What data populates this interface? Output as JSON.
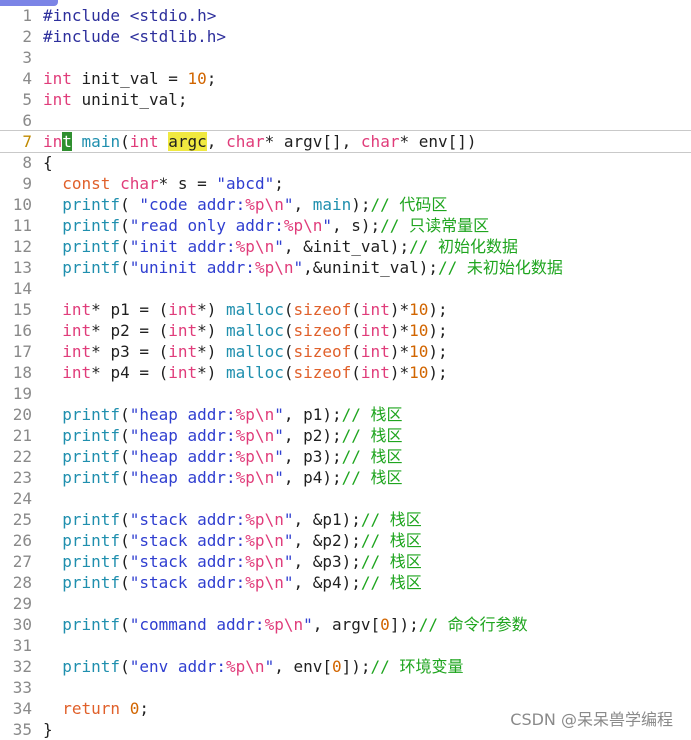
{
  "editor": {
    "current_line": 7,
    "lines": [
      {
        "n": "1",
        "t": [
          {
            "c": "tok-pp",
            "s": "#include <stdio.h>"
          }
        ]
      },
      {
        "n": "2",
        "t": [
          {
            "c": "tok-pp",
            "s": "#include <stdlib.h>"
          }
        ]
      },
      {
        "n": "3",
        "t": []
      },
      {
        "n": "4",
        "t": [
          {
            "c": "tok-type",
            "s": "int"
          },
          {
            "c": "tok-plain",
            "s": " init_val = "
          },
          {
            "c": "tok-num",
            "s": "10"
          },
          {
            "c": "tok-plain",
            "s": ";"
          }
        ]
      },
      {
        "n": "5",
        "t": [
          {
            "c": "tok-type",
            "s": "int"
          },
          {
            "c": "tok-plain",
            "s": " uninit_val;"
          }
        ]
      },
      {
        "n": "6",
        "t": []
      },
      {
        "n": "7",
        "t": [
          {
            "c": "tok-type",
            "s": "in"
          },
          {
            "c": "tok-cur",
            "s": "t"
          },
          {
            "c": "tok-plain",
            "s": " "
          },
          {
            "c": "tok-fn",
            "s": "main"
          },
          {
            "c": "tok-plain",
            "s": "("
          },
          {
            "c": "tok-type",
            "s": "int"
          },
          {
            "c": "tok-plain",
            "s": " "
          },
          {
            "c": "tok-hl tok-plain",
            "s": "argc"
          },
          {
            "c": "tok-plain",
            "s": ", "
          },
          {
            "c": "tok-type",
            "s": "char"
          },
          {
            "c": "tok-plain",
            "s": "* argv[], "
          },
          {
            "c": "tok-type",
            "s": "char"
          },
          {
            "c": "tok-plain",
            "s": "* env[])"
          }
        ]
      },
      {
        "n": "8",
        "t": [
          {
            "c": "tok-plain",
            "s": "{"
          }
        ]
      },
      {
        "n": "9",
        "t": [
          {
            "c": "tok-plain",
            "s": "  "
          },
          {
            "c": "tok-kw",
            "s": "const"
          },
          {
            "c": "tok-plain",
            "s": " "
          },
          {
            "c": "tok-type",
            "s": "char"
          },
          {
            "c": "tok-plain",
            "s": "* s = "
          },
          {
            "c": "tok-str",
            "s": "\"abcd\""
          },
          {
            "c": "tok-plain",
            "s": ";"
          }
        ]
      },
      {
        "n": "10",
        "t": [
          {
            "c": "tok-plain",
            "s": "  "
          },
          {
            "c": "tok-fn",
            "s": "printf"
          },
          {
            "c": "tok-plain",
            "s": "( "
          },
          {
            "c": "tok-str",
            "s": "\"code addr:"
          },
          {
            "c": "tok-fmt",
            "s": "%p\\n"
          },
          {
            "c": "tok-str",
            "s": "\""
          },
          {
            "c": "tok-plain",
            "s": ", "
          },
          {
            "c": "tok-fn",
            "s": "main"
          },
          {
            "c": "tok-plain",
            "s": ");"
          },
          {
            "c": "tok-cmt",
            "s": "// 代码区"
          }
        ]
      },
      {
        "n": "11",
        "t": [
          {
            "c": "tok-plain",
            "s": "  "
          },
          {
            "c": "tok-fn",
            "s": "printf"
          },
          {
            "c": "tok-plain",
            "s": "("
          },
          {
            "c": "tok-str",
            "s": "\"read only addr:"
          },
          {
            "c": "tok-fmt",
            "s": "%p\\n"
          },
          {
            "c": "tok-str",
            "s": "\""
          },
          {
            "c": "tok-plain",
            "s": ", s);"
          },
          {
            "c": "tok-cmt",
            "s": "// 只读常量区"
          }
        ]
      },
      {
        "n": "12",
        "t": [
          {
            "c": "tok-plain",
            "s": "  "
          },
          {
            "c": "tok-fn",
            "s": "printf"
          },
          {
            "c": "tok-plain",
            "s": "("
          },
          {
            "c": "tok-str",
            "s": "\"init addr:"
          },
          {
            "c": "tok-fmt",
            "s": "%p\\n"
          },
          {
            "c": "tok-str",
            "s": "\""
          },
          {
            "c": "tok-plain",
            "s": ", &init_val);"
          },
          {
            "c": "tok-cmt",
            "s": "// 初始化数据"
          }
        ]
      },
      {
        "n": "13",
        "t": [
          {
            "c": "tok-plain",
            "s": "  "
          },
          {
            "c": "tok-fn",
            "s": "printf"
          },
          {
            "c": "tok-plain",
            "s": "("
          },
          {
            "c": "tok-str",
            "s": "\"uninit addr:"
          },
          {
            "c": "tok-fmt",
            "s": "%p\\n"
          },
          {
            "c": "tok-str",
            "s": "\""
          },
          {
            "c": "tok-plain",
            "s": ",&uninit_val);"
          },
          {
            "c": "tok-cmt",
            "s": "// 未初始化数据"
          }
        ]
      },
      {
        "n": "14",
        "t": []
      },
      {
        "n": "15",
        "t": [
          {
            "c": "tok-plain",
            "s": "  "
          },
          {
            "c": "tok-type",
            "s": "int"
          },
          {
            "c": "tok-plain",
            "s": "* p1 = ("
          },
          {
            "c": "tok-type",
            "s": "int"
          },
          {
            "c": "tok-plain",
            "s": "*) "
          },
          {
            "c": "tok-fn",
            "s": "malloc"
          },
          {
            "c": "tok-plain",
            "s": "("
          },
          {
            "c": "tok-kw",
            "s": "sizeof"
          },
          {
            "c": "tok-plain",
            "s": "("
          },
          {
            "c": "tok-type",
            "s": "int"
          },
          {
            "c": "tok-plain",
            "s": ")*"
          },
          {
            "c": "tok-num",
            "s": "10"
          },
          {
            "c": "tok-plain",
            "s": ");"
          }
        ]
      },
      {
        "n": "16",
        "t": [
          {
            "c": "tok-plain",
            "s": "  "
          },
          {
            "c": "tok-type",
            "s": "int"
          },
          {
            "c": "tok-plain",
            "s": "* p2 = ("
          },
          {
            "c": "tok-type",
            "s": "int"
          },
          {
            "c": "tok-plain",
            "s": "*) "
          },
          {
            "c": "tok-fn",
            "s": "malloc"
          },
          {
            "c": "tok-plain",
            "s": "("
          },
          {
            "c": "tok-kw",
            "s": "sizeof"
          },
          {
            "c": "tok-plain",
            "s": "("
          },
          {
            "c": "tok-type",
            "s": "int"
          },
          {
            "c": "tok-plain",
            "s": ")*"
          },
          {
            "c": "tok-num",
            "s": "10"
          },
          {
            "c": "tok-plain",
            "s": ");"
          }
        ]
      },
      {
        "n": "17",
        "t": [
          {
            "c": "tok-plain",
            "s": "  "
          },
          {
            "c": "tok-type",
            "s": "int"
          },
          {
            "c": "tok-plain",
            "s": "* p3 = ("
          },
          {
            "c": "tok-type",
            "s": "int"
          },
          {
            "c": "tok-plain",
            "s": "*) "
          },
          {
            "c": "tok-fn",
            "s": "malloc"
          },
          {
            "c": "tok-plain",
            "s": "("
          },
          {
            "c": "tok-kw",
            "s": "sizeof"
          },
          {
            "c": "tok-plain",
            "s": "("
          },
          {
            "c": "tok-type",
            "s": "int"
          },
          {
            "c": "tok-plain",
            "s": ")*"
          },
          {
            "c": "tok-num",
            "s": "10"
          },
          {
            "c": "tok-plain",
            "s": ");"
          }
        ]
      },
      {
        "n": "18",
        "t": [
          {
            "c": "tok-plain",
            "s": "  "
          },
          {
            "c": "tok-type",
            "s": "int"
          },
          {
            "c": "tok-plain",
            "s": "* p4 = ("
          },
          {
            "c": "tok-type",
            "s": "int"
          },
          {
            "c": "tok-plain",
            "s": "*) "
          },
          {
            "c": "tok-fn",
            "s": "malloc"
          },
          {
            "c": "tok-plain",
            "s": "("
          },
          {
            "c": "tok-kw",
            "s": "sizeof"
          },
          {
            "c": "tok-plain",
            "s": "("
          },
          {
            "c": "tok-type",
            "s": "int"
          },
          {
            "c": "tok-plain",
            "s": ")*"
          },
          {
            "c": "tok-num",
            "s": "10"
          },
          {
            "c": "tok-plain",
            "s": ");"
          }
        ]
      },
      {
        "n": "19",
        "t": []
      },
      {
        "n": "20",
        "t": [
          {
            "c": "tok-plain",
            "s": "  "
          },
          {
            "c": "tok-fn",
            "s": "printf"
          },
          {
            "c": "tok-plain",
            "s": "("
          },
          {
            "c": "tok-str",
            "s": "\"heap addr:"
          },
          {
            "c": "tok-fmt",
            "s": "%p\\n"
          },
          {
            "c": "tok-str",
            "s": "\""
          },
          {
            "c": "tok-plain",
            "s": ", p1);"
          },
          {
            "c": "tok-cmt",
            "s": "// 栈区"
          }
        ]
      },
      {
        "n": "21",
        "t": [
          {
            "c": "tok-plain",
            "s": "  "
          },
          {
            "c": "tok-fn",
            "s": "printf"
          },
          {
            "c": "tok-plain",
            "s": "("
          },
          {
            "c": "tok-str",
            "s": "\"heap addr:"
          },
          {
            "c": "tok-fmt",
            "s": "%p\\n"
          },
          {
            "c": "tok-str",
            "s": "\""
          },
          {
            "c": "tok-plain",
            "s": ", p2);"
          },
          {
            "c": "tok-cmt",
            "s": "// 栈区"
          }
        ]
      },
      {
        "n": "22",
        "t": [
          {
            "c": "tok-plain",
            "s": "  "
          },
          {
            "c": "tok-fn",
            "s": "printf"
          },
          {
            "c": "tok-plain",
            "s": "("
          },
          {
            "c": "tok-str",
            "s": "\"heap addr:"
          },
          {
            "c": "tok-fmt",
            "s": "%p\\n"
          },
          {
            "c": "tok-str",
            "s": "\""
          },
          {
            "c": "tok-plain",
            "s": ", p3);"
          },
          {
            "c": "tok-cmt",
            "s": "// 栈区"
          }
        ]
      },
      {
        "n": "23",
        "t": [
          {
            "c": "tok-plain",
            "s": "  "
          },
          {
            "c": "tok-fn",
            "s": "printf"
          },
          {
            "c": "tok-plain",
            "s": "("
          },
          {
            "c": "tok-str",
            "s": "\"heap addr:"
          },
          {
            "c": "tok-fmt",
            "s": "%p\\n"
          },
          {
            "c": "tok-str",
            "s": "\""
          },
          {
            "c": "tok-plain",
            "s": ", p4);"
          },
          {
            "c": "tok-cmt",
            "s": "// 栈区"
          }
        ]
      },
      {
        "n": "24",
        "t": []
      },
      {
        "n": "25",
        "t": [
          {
            "c": "tok-plain",
            "s": "  "
          },
          {
            "c": "tok-fn",
            "s": "printf"
          },
          {
            "c": "tok-plain",
            "s": "("
          },
          {
            "c": "tok-str",
            "s": "\"stack addr:"
          },
          {
            "c": "tok-fmt",
            "s": "%p\\n"
          },
          {
            "c": "tok-str",
            "s": "\""
          },
          {
            "c": "tok-plain",
            "s": ", &p1);"
          },
          {
            "c": "tok-cmt",
            "s": "// 栈区"
          }
        ]
      },
      {
        "n": "26",
        "t": [
          {
            "c": "tok-plain",
            "s": "  "
          },
          {
            "c": "tok-fn",
            "s": "printf"
          },
          {
            "c": "tok-plain",
            "s": "("
          },
          {
            "c": "tok-str",
            "s": "\"stack addr:"
          },
          {
            "c": "tok-fmt",
            "s": "%p\\n"
          },
          {
            "c": "tok-str",
            "s": "\""
          },
          {
            "c": "tok-plain",
            "s": ", &p2);"
          },
          {
            "c": "tok-cmt",
            "s": "// 栈区"
          }
        ]
      },
      {
        "n": "27",
        "t": [
          {
            "c": "tok-plain",
            "s": "  "
          },
          {
            "c": "tok-fn",
            "s": "printf"
          },
          {
            "c": "tok-plain",
            "s": "("
          },
          {
            "c": "tok-str",
            "s": "\"stack addr:"
          },
          {
            "c": "tok-fmt",
            "s": "%p\\n"
          },
          {
            "c": "tok-str",
            "s": "\""
          },
          {
            "c": "tok-plain",
            "s": ", &p3);"
          },
          {
            "c": "tok-cmt",
            "s": "// 栈区"
          }
        ]
      },
      {
        "n": "28",
        "t": [
          {
            "c": "tok-plain",
            "s": "  "
          },
          {
            "c": "tok-fn",
            "s": "printf"
          },
          {
            "c": "tok-plain",
            "s": "("
          },
          {
            "c": "tok-str",
            "s": "\"stack addr:"
          },
          {
            "c": "tok-fmt",
            "s": "%p\\n"
          },
          {
            "c": "tok-str",
            "s": "\""
          },
          {
            "c": "tok-plain",
            "s": ", &p4);"
          },
          {
            "c": "tok-cmt",
            "s": "// 栈区"
          }
        ]
      },
      {
        "n": "29",
        "t": []
      },
      {
        "n": "30",
        "t": [
          {
            "c": "tok-plain",
            "s": "  "
          },
          {
            "c": "tok-fn",
            "s": "printf"
          },
          {
            "c": "tok-plain",
            "s": "("
          },
          {
            "c": "tok-str",
            "s": "\"command addr:"
          },
          {
            "c": "tok-fmt",
            "s": "%p\\n"
          },
          {
            "c": "tok-str",
            "s": "\""
          },
          {
            "c": "tok-plain",
            "s": ", argv["
          },
          {
            "c": "tok-num",
            "s": "0"
          },
          {
            "c": "tok-plain",
            "s": "]);"
          },
          {
            "c": "tok-cmt",
            "s": "// 命令行参数"
          }
        ]
      },
      {
        "n": "31",
        "t": []
      },
      {
        "n": "32",
        "t": [
          {
            "c": "tok-plain",
            "s": "  "
          },
          {
            "c": "tok-fn",
            "s": "printf"
          },
          {
            "c": "tok-plain",
            "s": "("
          },
          {
            "c": "tok-str",
            "s": "\"env addr:"
          },
          {
            "c": "tok-fmt",
            "s": "%p\\n"
          },
          {
            "c": "tok-str",
            "s": "\""
          },
          {
            "c": "tok-plain",
            "s": ", env["
          },
          {
            "c": "tok-num",
            "s": "0"
          },
          {
            "c": "tok-plain",
            "s": "]);"
          },
          {
            "c": "tok-cmt",
            "s": "// 环境变量"
          }
        ]
      },
      {
        "n": "33",
        "t": []
      },
      {
        "n": "34",
        "t": [
          {
            "c": "tok-plain",
            "s": "  "
          },
          {
            "c": "tok-kw",
            "s": "return"
          },
          {
            "c": "tok-plain",
            "s": " "
          },
          {
            "c": "tok-num",
            "s": "0"
          },
          {
            "c": "tok-plain",
            "s": ";"
          }
        ]
      },
      {
        "n": "35",
        "t": [
          {
            "c": "tok-plain",
            "s": "}"
          }
        ]
      }
    ]
  },
  "watermark": "CSDN @呆呆兽学编程",
  "colors": {
    "background": "#ffffff",
    "line_number": "#8a8a8a",
    "keyword_type": "#e03c7a",
    "function": "#1f8fae",
    "string": "#2f3ed0",
    "number": "#d16500",
    "comment": "#1fa51f",
    "search_highlight": "#f0e940",
    "cursor": "#2f8f2f"
  }
}
